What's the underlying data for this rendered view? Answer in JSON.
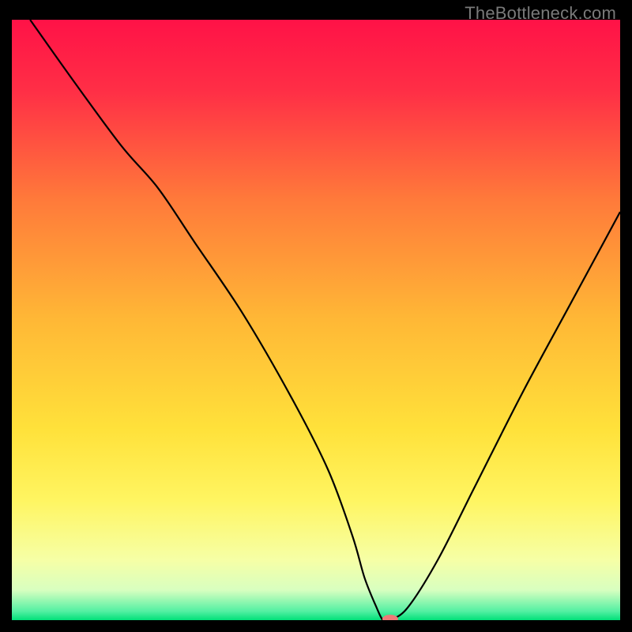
{
  "attribution": "TheBottleneck.com",
  "chart_data": {
    "type": "line",
    "title": "",
    "xlabel": "",
    "ylabel": "",
    "xlim": [
      0,
      100
    ],
    "ylim": [
      0,
      100
    ],
    "grid": false,
    "legend": false,
    "background": {
      "type": "vertical-gradient",
      "stops": [
        {
          "pos": 0.0,
          "color": "#ff1247"
        },
        {
          "pos": 0.12,
          "color": "#ff2f46"
        },
        {
          "pos": 0.3,
          "color": "#ff7a3a"
        },
        {
          "pos": 0.5,
          "color": "#ffb836"
        },
        {
          "pos": 0.68,
          "color": "#ffe13a"
        },
        {
          "pos": 0.8,
          "color": "#fff561"
        },
        {
          "pos": 0.9,
          "color": "#f6ffa6"
        },
        {
          "pos": 0.95,
          "color": "#d8ffc0"
        },
        {
          "pos": 0.985,
          "color": "#54f0a3"
        },
        {
          "pos": 1.0,
          "color": "#00e079"
        }
      ]
    },
    "series": [
      {
        "name": "bottleneck-curve",
        "color": "#000000",
        "width": 2.2,
        "x": [
          3,
          10,
          18,
          24,
          30,
          38,
          46,
          52,
          56,
          58,
          60,
          61,
          62,
          65,
          70,
          76,
          84,
          92,
          100
        ],
        "y": [
          100,
          90,
          79,
          72,
          63,
          51,
          37,
          25,
          14,
          7,
          2,
          0,
          0,
          2,
          10,
          22,
          38,
          53,
          68
        ]
      }
    ],
    "marker": {
      "name": "minimum-marker",
      "x": 62.2,
      "y": 0.2,
      "rx": 1.3,
      "ry": 0.7,
      "fill": "#ef7b78"
    }
  }
}
